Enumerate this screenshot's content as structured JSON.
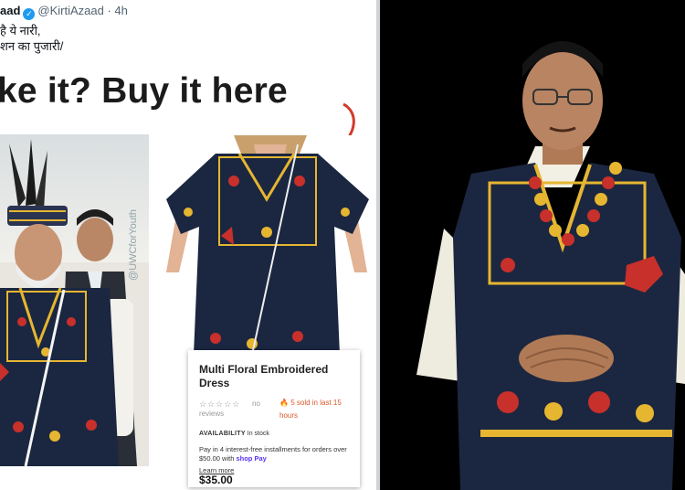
{
  "tweet": {
    "name_fragment": "aad",
    "handle": "@KirtiAzaad",
    "time": "· 4h",
    "line1": "है ये नारी,",
    "line2": "शन का पुजारी/",
    "headline": "ke it? Buy it here"
  },
  "photo1": {
    "watermark": "@UWCforYouth"
  },
  "product": {
    "title": "Multi Floral Embroidered Dress",
    "stars": "☆☆☆☆☆",
    "reviews_a": "no",
    "reviews_b": "reviews",
    "sold": "5 sold in last 15 hours",
    "availability_label": "AVAILABILITY",
    "availability_value": "In stock",
    "pay_text": "Pay in 4 interest-free installments for orders over $50.00 with",
    "shop_pay": "shop Pay",
    "learn_more": "Learn more",
    "price": "$35.00"
  },
  "colors": {
    "vest": "#1b2740",
    "embroidery": "#e6b631",
    "accent_red": "#c8302b",
    "verified": "#1d9bf0"
  }
}
